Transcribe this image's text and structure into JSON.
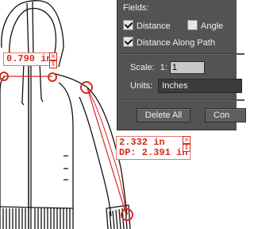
{
  "panel": {
    "fields_label": "Fields:",
    "checkboxes": [
      {
        "label": "Distance",
        "checked": true
      },
      {
        "label": "Angle",
        "checked": false
      },
      {
        "label": "Distance Along Path",
        "checked": true
      }
    ],
    "scale_label": "Scale:",
    "scale_ratio": "1:",
    "scale_value": "1",
    "units_label": "Units:",
    "units_value": "Inches",
    "delete_all_label": "Delete All",
    "cont_label": "Con"
  },
  "measurements": [
    {
      "line1": "0.790 in"
    },
    {
      "line1": "2.332 in",
      "line2": "DP: 2.391 in"
    }
  ],
  "icons": {
    "close": "×",
    "arrow": "⇕"
  },
  "colors": {
    "accent": "#d8281c",
    "panel_bg": "#535353"
  }
}
